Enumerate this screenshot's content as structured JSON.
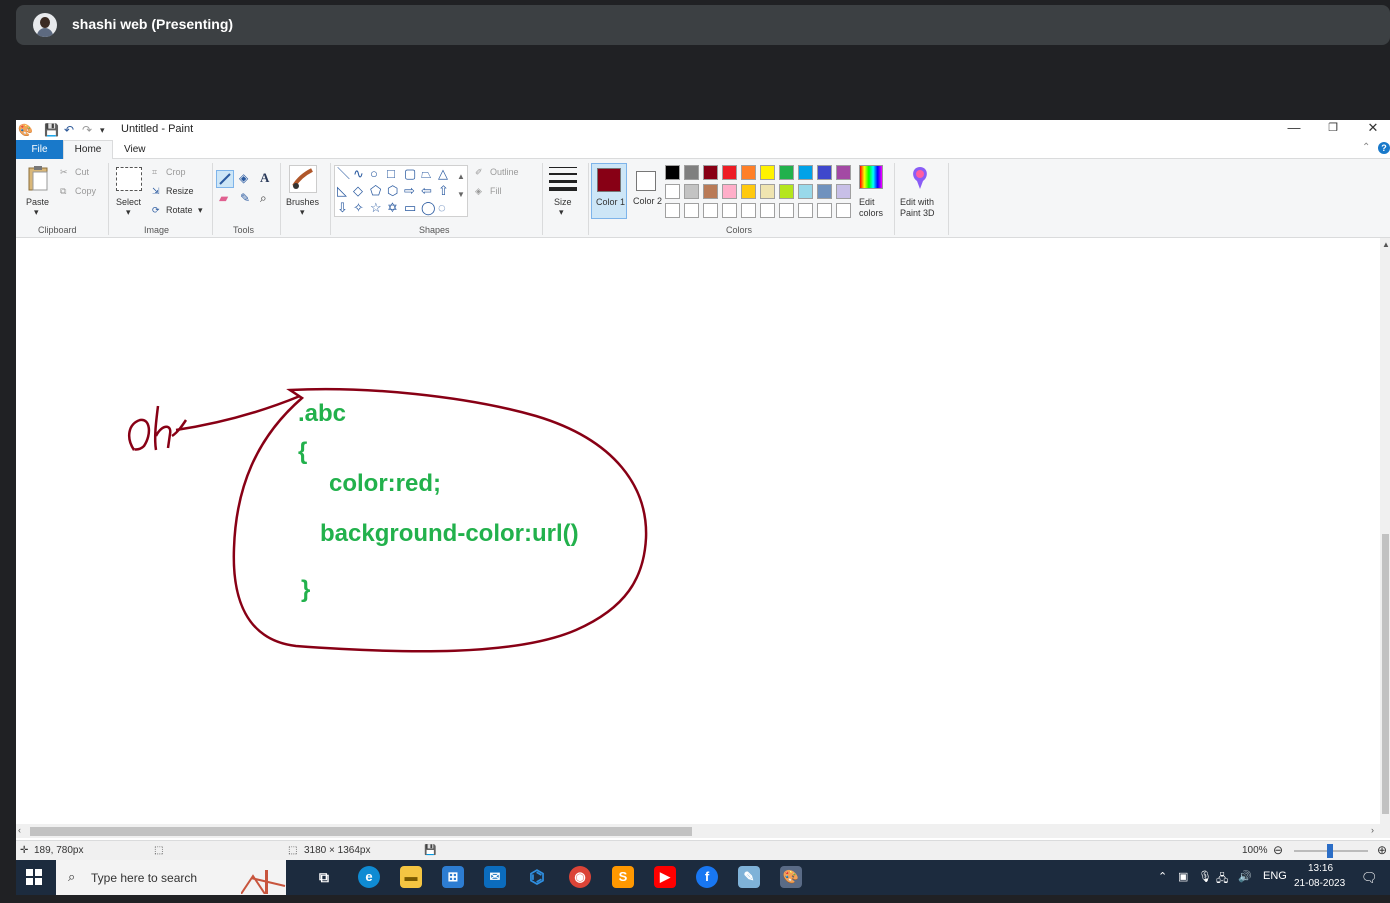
{
  "presenter": {
    "name": "shashi web (Presenting)"
  },
  "paint": {
    "window_title": "Untitled - Paint",
    "window_buttons": {
      "minimize": "—",
      "restore": "❐",
      "close": "✕"
    },
    "tabs": {
      "file": "File",
      "home": "Home",
      "view": "View"
    },
    "help": "?",
    "ribbon": {
      "clipboard": {
        "paste": "Paste",
        "cut": "Cut",
        "copy": "Copy",
        "label": "Clipboard"
      },
      "image": {
        "select": "Select",
        "crop": "Crop",
        "resize": "Resize",
        "rotate": "Rotate",
        "label": "Image"
      },
      "tools": {
        "label": "Tools"
      },
      "brushes": {
        "label": "Brushes"
      },
      "shapes": {
        "outline": "Outline",
        "fill": "Fill",
        "label": "Shapes"
      },
      "size": {
        "label": "Size"
      },
      "colors": {
        "color1": "Color 1",
        "color2": "Color 2",
        "edit_colors": "Edit colors",
        "edit_with_3d": "Edit with Paint 3D",
        "label": "Colors",
        "color1_value": "#880015",
        "color2_value": "#ffffff",
        "palette_row1": [
          "#000000",
          "#7f7f7f",
          "#880015",
          "#ed1c24",
          "#ff7f27",
          "#fff200",
          "#22b14c",
          "#00a2e8",
          "#3f48cc",
          "#a349a4"
        ],
        "palette_row2": [
          "#ffffff",
          "#c3c3c3",
          "#b97a57",
          "#ffaec9",
          "#ffc90e",
          "#efe4b0",
          "#b5e61d",
          "#99d9ea",
          "#7092be",
          "#c8bfe7"
        ],
        "palette_row3": [
          "#ffffff",
          "#ffffff",
          "#ffffff",
          "#ffffff",
          "#ffffff",
          "#ffffff",
          "#ffffff",
          "#ffffff",
          "#ffffff",
          "#ffffff"
        ]
      }
    },
    "canvas": {
      "handwriting": "oh",
      "code_lines": [
        ".abc",
        "{",
        "color:red;",
        "background-color:url()",
        "}"
      ],
      "code_color": "#22b14c",
      "ink_color": "#880015"
    },
    "status": {
      "cursor_pos": "189, 780px",
      "canvas_size": "3180 × 1364px",
      "zoom": "100%"
    }
  },
  "taskbar": {
    "search_placeholder": "Type here to search",
    "language": "ENG",
    "time": "13:16",
    "date": "21-08-2023"
  }
}
